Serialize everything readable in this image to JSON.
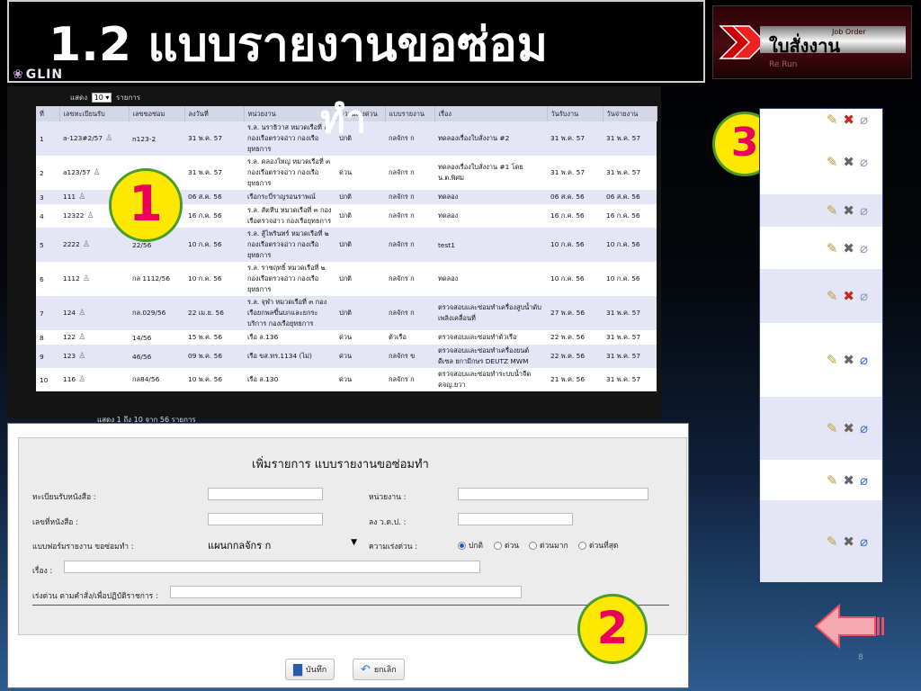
{
  "slide": {
    "title": "1.2 แบบรายงานขอซ่อม",
    "title_wrap": "ทำ",
    "logo_text": "GLIN",
    "page_number": "8"
  },
  "job_order_logo": {
    "en": "Job Order",
    "th": "ใบสั่งงาน",
    "sub": "Re Run"
  },
  "table": {
    "show_label": "แสดง",
    "page_size": "10",
    "records_label": "รายการ",
    "footer": "แสดง 1 ถึง 10 จาก 56 รายการ",
    "columns": [
      "ที่",
      "เลขทะเบียนรับ",
      "เลขขอซ่อม",
      "ลงวันที่",
      "หน่วยงาน",
      "ความเร่งด่วน",
      "แบบรายงาน",
      "เรื่อง",
      "วันรับงาน",
      "วันจ่ายงาน"
    ],
    "rows": [
      [
        "1",
        "a-123#2/57",
        "n123-2",
        "31 พ.ค. 57",
        "ร.ล. นราธิวาส หมวดเรือที่ ๑ กองเรือตรวจอ่าว กองเรือยุทธการ",
        "ปกติ",
        "กลจักร ก",
        "ทดลองเรื่องใบสั่งงาน #2",
        "31 พ.ค. 57",
        "31 พ.ค. 57"
      ],
      [
        "2",
        "a123/57",
        "",
        "31 พ.ค. 57",
        "ร.ล. คลองใหญ่ หมวดเรือที่ ๓ กองเรือตรวจอ่าว กองเรือยุทธการ",
        "ด่วน",
        "กลจักร ก",
        "ทดลองเรื่องใบสั่งงาน #1 โดย น.ต.พิศม",
        "31 พ.ค. 57",
        "31 พ.ค. 57"
      ],
      [
        "3",
        "111",
        "",
        "06 ส.ค. 56",
        "เรือกระบี่ราญรอนราพณ์",
        "ปกติ",
        "กลจักร ก",
        "ทดลอง",
        "06 ส.ค. 56",
        "06 ส.ค. 56"
      ],
      [
        "4",
        "12322",
        "",
        "16 ก.ค. 56",
        "ร.ล. สัตหีบ หมวดเรือที่ ๓ กองเรือตรวจอ่าว กองเรือยุทธการ",
        "ปกติ",
        "กลจักร ก",
        "ทดลอง",
        "16 ก.ค. 56",
        "16 ก.ค. 56"
      ],
      [
        "5",
        "2222",
        "22/56",
        "10 ก.ค. 56",
        "ร.ล. สู้ไพรินทร์ หมวดเรือที่ ๒ กองเรือตรวจอ่าว กองเรือยุทธการ",
        "ปกติ",
        "กลจักร ก",
        "test1",
        "10 ก.ค. 56",
        "10 ก.ค. 56"
      ],
      [
        "6",
        "1112",
        "กล 1112/56",
        "10 ก.ค. 56",
        "ร.ล. ราชฤทธิ์ หมวดเรือที่ ๒ กองเรือตรวจอ่าว กองเรือยุทธการ",
        "ปกติ",
        "กลจักร ก",
        "ทดลอง",
        "10 ก.ค. 56",
        "10 ก.ค. 56"
      ],
      [
        "7",
        "124",
        "กล.029/56",
        "22 เม.ย. 56",
        "ร.ล. จุฬา หมวดเรือที่ ๓ กองเรือยกพลขึ้นบกและยกระบริการ กองเรือยุทธการ",
        "ปกติ",
        "กลจักร ก",
        "ตรวจสอบและซ่อมทำเครื่องสูบน้ำดับเพลิงเคลื่อนที่",
        "27 พ.ค. 56",
        "31 พ.ค. 57"
      ],
      [
        "8",
        "122",
        "14/56",
        "15 พ.ค. 56",
        "เรือ ล.136",
        "ด่วน",
        "ตัวเรือ",
        "ตรวจสอบและซ่อมทำตัวเรือ",
        "22 พ.ค. 56",
        "31 พ.ค. 57"
      ],
      [
        "9",
        "123",
        "46/56",
        "09 พ.ค. 56",
        "เรือ ขส.ทร.1134 (ไม่)",
        "ด่วน",
        "กลจักร ข",
        "ตรวจสอบและซ่อมทำเครื่องยนต์ดีเซล ยกามีกษร DEUTZ MWM",
        "22 พ.ค. 56",
        "31 พ.ค. 57"
      ],
      [
        "10",
        "116",
        "กล84/56",
        "10 พ.ค. 56",
        "เรือ ล.130",
        "ด่วน",
        "กลจักร ก",
        "ตรวจสอบและซ่อมทำระบบน้ำจืด คจญ.ยวา",
        "21 พ.ค. 56",
        "31 พ.ค. 57"
      ]
    ]
  },
  "markers": {
    "one": "1",
    "two": "2",
    "three": "3"
  },
  "actions": [
    {
      "delete": "red",
      "clip": "grey"
    },
    {
      "delete": "grey",
      "clip": "grey"
    },
    {
      "delete": "grey",
      "clip": "grey"
    },
    {
      "delete": "grey",
      "clip": "grey"
    },
    {
      "delete": "red",
      "clip": "grey"
    },
    {
      "delete": "grey",
      "clip": "blue"
    },
    {
      "delete": "grey",
      "clip": "blue"
    },
    {
      "delete": "grey",
      "clip": "blue"
    },
    {
      "delete": "grey",
      "clip": "blue"
    }
  ],
  "form": {
    "title": "เพิ่มรายการ แบบรายงานขอซ่อมทำ",
    "reg_label": "ทะเบียนรับหนังสือ :",
    "unit_label": "หน่วยงาน :",
    "doc_no_label": "เลขที่หนังสือ :",
    "date_label": "ลง ว.ด.ป. :",
    "form_type_label": "แบบฟอร์มรายงาน ขอซ่อมทำ  :",
    "form_type_value": "แผนกกลจักร ก",
    "urgency_label": "ความเร่งด่วน :",
    "urgency_options": [
      "ปกติ",
      "ด่วน",
      "ด่วนมาก",
      "ด่วนที่สุด"
    ],
    "urgency_selected": "ปกติ",
    "subject_label": "เรื่อง :",
    "urgent_cmd_label": "เร่งด่วน ตามคำสั่ง/เพื่อปฏิบัติราชการ :",
    "save_label": "บันทึก",
    "cancel_label": "ยกเลิก"
  }
}
